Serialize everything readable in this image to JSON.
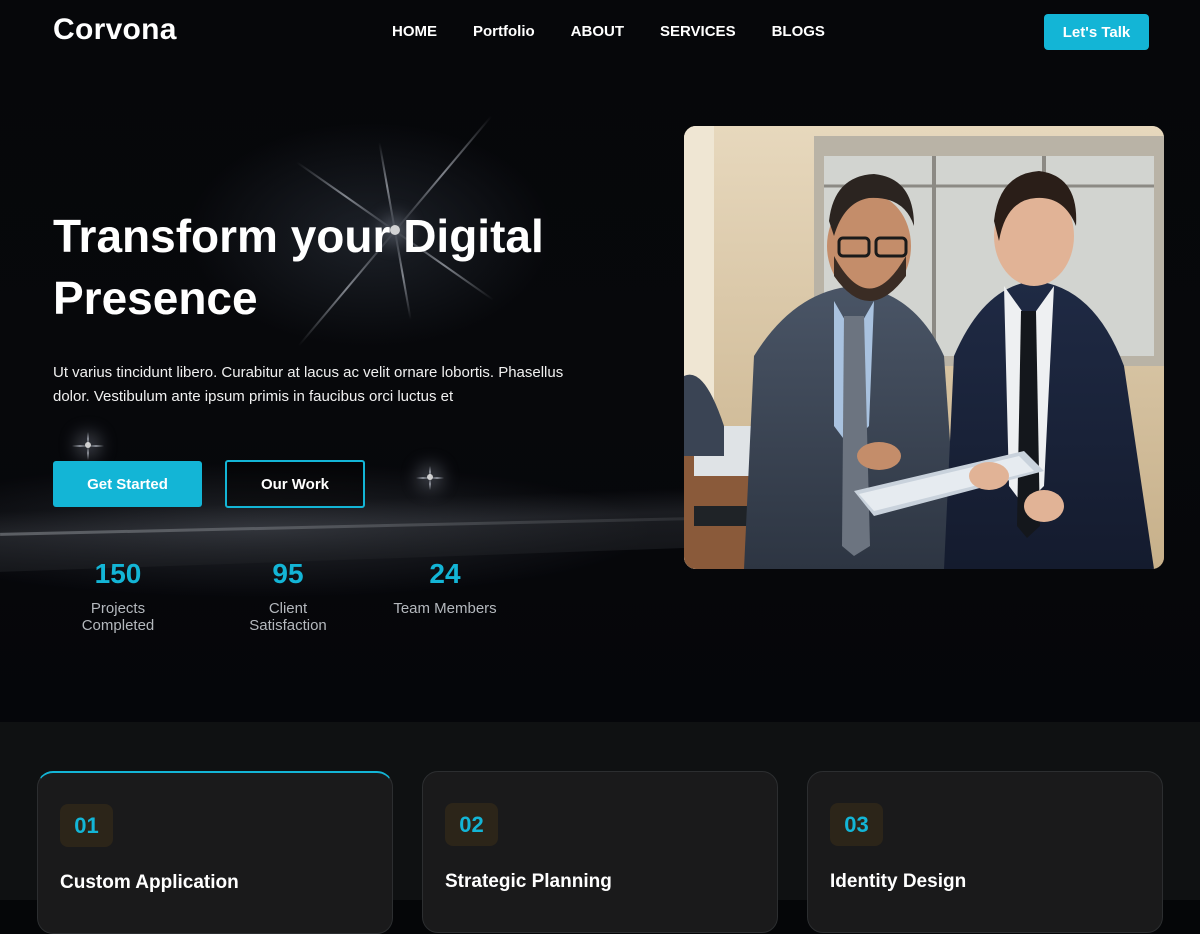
{
  "brand": {
    "logo": "Corvona",
    "accent": "#13b5d6"
  },
  "nav": {
    "items": [
      {
        "label": "HOME"
      },
      {
        "label": "Portfolio"
      },
      {
        "label": "ABOUT"
      },
      {
        "label": "SERVICES"
      },
      {
        "label": "BLOGS"
      }
    ],
    "cta": "Let's Talk"
  },
  "hero": {
    "title_line1": "Transform your Digital",
    "title_line2": "Presence",
    "description": "Ut varius tincidunt libero. Curabitur at lacus ac velit ornare lobortis. Phasellus dolor. Vestibulum ante ipsum primis in faucibus orci luctus et",
    "primary_button": "Get Started",
    "secondary_button": "Our Work",
    "stats": [
      {
        "value": "150",
        "label": "Projects Completed"
      },
      {
        "value": "95",
        "label": "Client Satisfaction"
      },
      {
        "value": "24",
        "label": "Team Members"
      }
    ]
  },
  "services": {
    "cards": [
      {
        "number": "01",
        "title": "Custom Application"
      },
      {
        "number": "02",
        "title": "Strategic Planning"
      },
      {
        "number": "03",
        "title": "Identity Design"
      }
    ]
  }
}
